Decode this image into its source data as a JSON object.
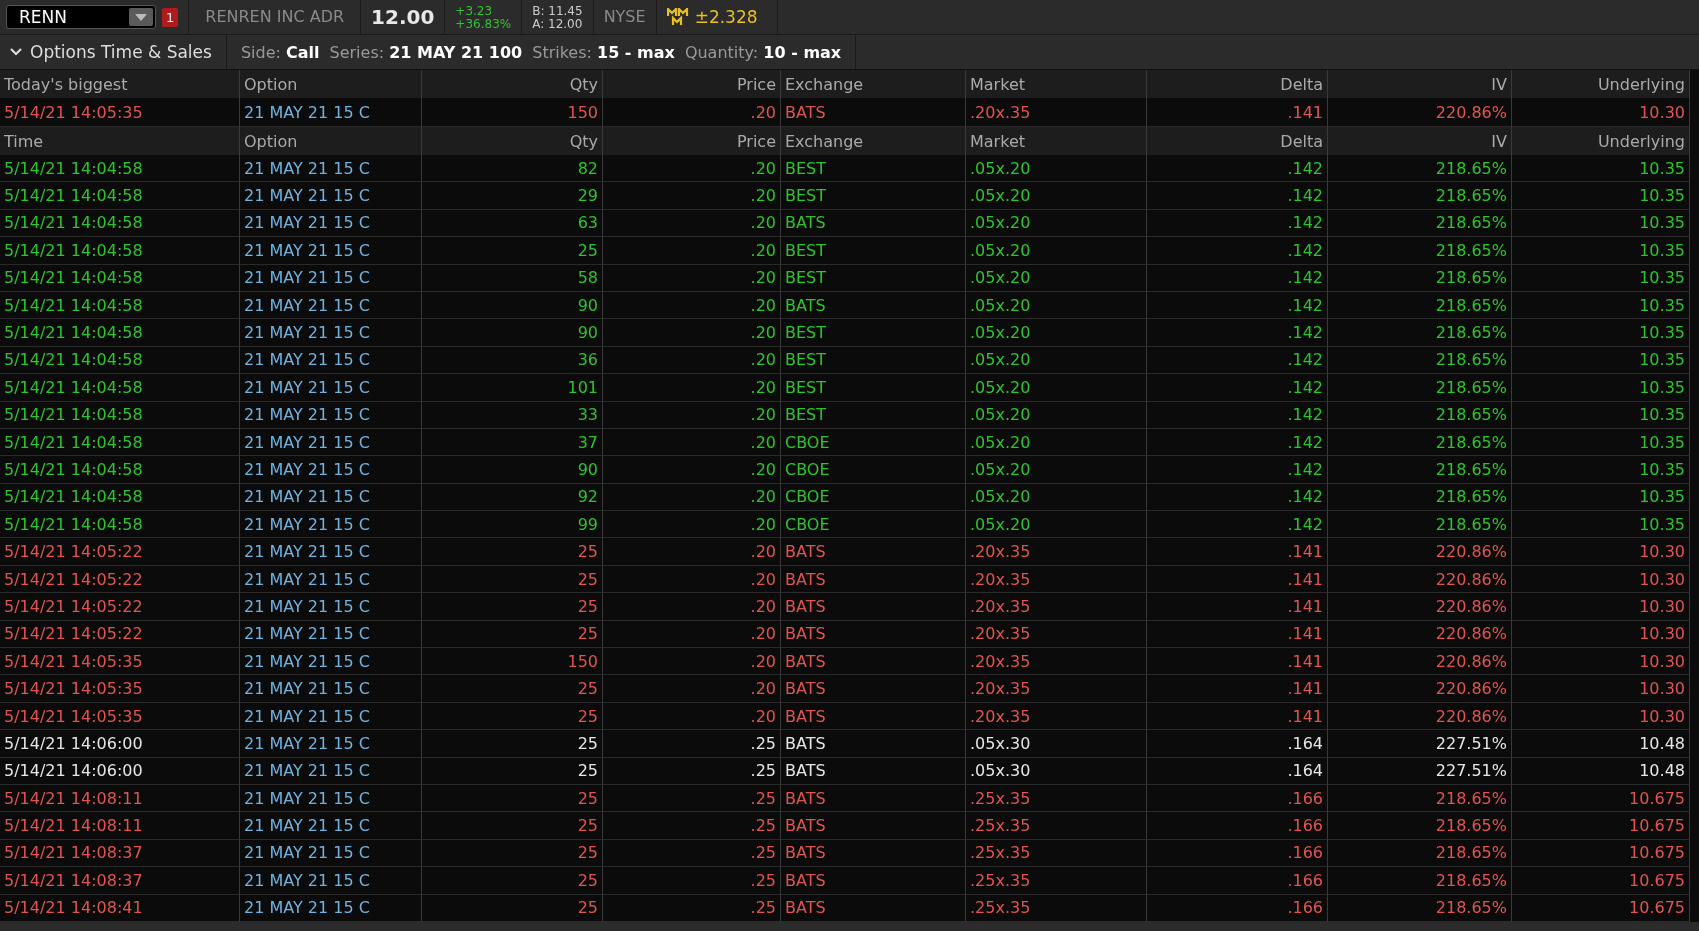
{
  "quote_bar": {
    "symbol": "RENN",
    "alert_count": "1",
    "company": "RENREN INC ADR",
    "last": "12.00",
    "change": "+3.23",
    "change_pct": "+36.83%",
    "bid": "B: 11.45",
    "ask": "A: 12.00",
    "exchange": "NYSE",
    "expected_move": "±2.328"
  },
  "panel": {
    "title": "Options Time & Sales",
    "expanded": true,
    "filters": [
      {
        "label": "Side:",
        "value": "Call"
      },
      {
        "label": "Series:",
        "value": "21 MAY 21 100"
      },
      {
        "label": "Strikes:",
        "value": "15 - max"
      },
      {
        "label": "Quantity:",
        "value": "10 - max"
      }
    ]
  },
  "biggest": {
    "columns": [
      "Today's biggest",
      "Option",
      "Qty",
      "Price",
      "Exchange",
      "Market",
      "Delta",
      "IV",
      "Underlying"
    ],
    "row": {
      "color": "#e0554f",
      "time": "5/14/21 14:05:35",
      "option": "21 MAY 21 15 C",
      "qty": "150",
      "price": ".20",
      "exchange": "BATS",
      "market": ".20x.35",
      "delta": ".141",
      "iv": "220.86%",
      "underlying": "10.30"
    }
  },
  "table": {
    "columns": [
      "Time",
      "Option",
      "Qty",
      "Price",
      "Exchange",
      "Market",
      "Delta",
      "IV",
      "Underlying"
    ],
    "rows": [
      {
        "color": "#2ec42e",
        "time": "5/14/21 14:04:58",
        "option": "21 MAY 21 15 C",
        "qty": "82",
        "price": ".20",
        "exchange": "BEST",
        "market": ".05x.20",
        "delta": ".142",
        "iv": "218.65%",
        "underlying": "10.35"
      },
      {
        "color": "#2ec42e",
        "time": "5/14/21 14:04:58",
        "option": "21 MAY 21 15 C",
        "qty": "29",
        "price": ".20",
        "exchange": "BEST",
        "market": ".05x.20",
        "delta": ".142",
        "iv": "218.65%",
        "underlying": "10.35"
      },
      {
        "color": "#2ec42e",
        "time": "5/14/21 14:04:58",
        "option": "21 MAY 21 15 C",
        "qty": "63",
        "price": ".20",
        "exchange": "BATS",
        "market": ".05x.20",
        "delta": ".142",
        "iv": "218.65%",
        "underlying": "10.35"
      },
      {
        "color": "#2ec42e",
        "time": "5/14/21 14:04:58",
        "option": "21 MAY 21 15 C",
        "qty": "25",
        "price": ".20",
        "exchange": "BEST",
        "market": ".05x.20",
        "delta": ".142",
        "iv": "218.65%",
        "underlying": "10.35"
      },
      {
        "color": "#2ec42e",
        "time": "5/14/21 14:04:58",
        "option": "21 MAY 21 15 C",
        "qty": "58",
        "price": ".20",
        "exchange": "BEST",
        "market": ".05x.20",
        "delta": ".142",
        "iv": "218.65%",
        "underlying": "10.35"
      },
      {
        "color": "#2ec42e",
        "time": "5/14/21 14:04:58",
        "option": "21 MAY 21 15 C",
        "qty": "90",
        "price": ".20",
        "exchange": "BATS",
        "market": ".05x.20",
        "delta": ".142",
        "iv": "218.65%",
        "underlying": "10.35"
      },
      {
        "color": "#2ec42e",
        "time": "5/14/21 14:04:58",
        "option": "21 MAY 21 15 C",
        "qty": "90",
        "price": ".20",
        "exchange": "BEST",
        "market": ".05x.20",
        "delta": ".142",
        "iv": "218.65%",
        "underlying": "10.35"
      },
      {
        "color": "#2ec42e",
        "time": "5/14/21 14:04:58",
        "option": "21 MAY 21 15 C",
        "qty": "36",
        "price": ".20",
        "exchange": "BEST",
        "market": ".05x.20",
        "delta": ".142",
        "iv": "218.65%",
        "underlying": "10.35"
      },
      {
        "color": "#2ec42e",
        "time": "5/14/21 14:04:58",
        "option": "21 MAY 21 15 C",
        "qty": "101",
        "price": ".20",
        "exchange": "BEST",
        "market": ".05x.20",
        "delta": ".142",
        "iv": "218.65%",
        "underlying": "10.35"
      },
      {
        "color": "#2ec42e",
        "time": "5/14/21 14:04:58",
        "option": "21 MAY 21 15 C",
        "qty": "33",
        "price": ".20",
        "exchange": "BEST",
        "market": ".05x.20",
        "delta": ".142",
        "iv": "218.65%",
        "underlying": "10.35"
      },
      {
        "color": "#2ec42e",
        "time": "5/14/21 14:04:58",
        "option": "21 MAY 21 15 C",
        "qty": "37",
        "price": ".20",
        "exchange": "CBOE",
        "market": ".05x.20",
        "delta": ".142",
        "iv": "218.65%",
        "underlying": "10.35"
      },
      {
        "color": "#2ec42e",
        "time": "5/14/21 14:04:58",
        "option": "21 MAY 21 15 C",
        "qty": "90",
        "price": ".20",
        "exchange": "CBOE",
        "market": ".05x.20",
        "delta": ".142",
        "iv": "218.65%",
        "underlying": "10.35"
      },
      {
        "color": "#2ec42e",
        "time": "5/14/21 14:04:58",
        "option": "21 MAY 21 15 C",
        "qty": "92",
        "price": ".20",
        "exchange": "CBOE",
        "market": ".05x.20",
        "delta": ".142",
        "iv": "218.65%",
        "underlying": "10.35"
      },
      {
        "color": "#2ec42e",
        "time": "5/14/21 14:04:58",
        "option": "21 MAY 21 15 C",
        "qty": "99",
        "price": ".20",
        "exchange": "CBOE",
        "market": ".05x.20",
        "delta": ".142",
        "iv": "218.65%",
        "underlying": "10.35"
      },
      {
        "color": "#e0554f",
        "time": "5/14/21 14:05:22",
        "option": "21 MAY 21 15 C",
        "qty": "25",
        "price": ".20",
        "exchange": "BATS",
        "market": ".20x.35",
        "delta": ".141",
        "iv": "220.86%",
        "underlying": "10.30"
      },
      {
        "color": "#e0554f",
        "time": "5/14/21 14:05:22",
        "option": "21 MAY 21 15 C",
        "qty": "25",
        "price": ".20",
        "exchange": "BATS",
        "market": ".20x.35",
        "delta": ".141",
        "iv": "220.86%",
        "underlying": "10.30"
      },
      {
        "color": "#e0554f",
        "time": "5/14/21 14:05:22",
        "option": "21 MAY 21 15 C",
        "qty": "25",
        "price": ".20",
        "exchange": "BATS",
        "market": ".20x.35",
        "delta": ".141",
        "iv": "220.86%",
        "underlying": "10.30"
      },
      {
        "color": "#e0554f",
        "time": "5/14/21 14:05:22",
        "option": "21 MAY 21 15 C",
        "qty": "25",
        "price": ".20",
        "exchange": "BATS",
        "market": ".20x.35",
        "delta": ".141",
        "iv": "220.86%",
        "underlying": "10.30"
      },
      {
        "color": "#e0554f",
        "time": "5/14/21 14:05:35",
        "option": "21 MAY 21 15 C",
        "qty": "150",
        "price": ".20",
        "exchange": "BATS",
        "market": ".20x.35",
        "delta": ".141",
        "iv": "220.86%",
        "underlying": "10.30"
      },
      {
        "color": "#e0554f",
        "time": "5/14/21 14:05:35",
        "option": "21 MAY 21 15 C",
        "qty": "25",
        "price": ".20",
        "exchange": "BATS",
        "market": ".20x.35",
        "delta": ".141",
        "iv": "220.86%",
        "underlying": "10.30"
      },
      {
        "color": "#e0554f",
        "time": "5/14/21 14:05:35",
        "option": "21 MAY 21 15 C",
        "qty": "25",
        "price": ".20",
        "exchange": "BATS",
        "market": ".20x.35",
        "delta": ".141",
        "iv": "220.86%",
        "underlying": "10.30"
      },
      {
        "color": "#e6e6e6",
        "time": "5/14/21 14:06:00",
        "option": "21 MAY 21 15 C",
        "qty": "25",
        "price": ".25",
        "exchange": "BATS",
        "market": ".05x.30",
        "delta": ".164",
        "iv": "227.51%",
        "underlying": "10.48"
      },
      {
        "color": "#e6e6e6",
        "time": "5/14/21 14:06:00",
        "option": "21 MAY 21 15 C",
        "qty": "25",
        "price": ".25",
        "exchange": "BATS",
        "market": ".05x.30",
        "delta": ".164",
        "iv": "227.51%",
        "underlying": "10.48"
      },
      {
        "color": "#e0554f",
        "time": "5/14/21 14:08:11",
        "option": "21 MAY 21 15 C",
        "qty": "25",
        "price": ".25",
        "exchange": "BATS",
        "market": ".25x.35",
        "delta": ".166",
        "iv": "218.65%",
        "underlying": "10.675"
      },
      {
        "color": "#e0554f",
        "time": "5/14/21 14:08:11",
        "option": "21 MAY 21 15 C",
        "qty": "25",
        "price": ".25",
        "exchange": "BATS",
        "market": ".25x.35",
        "delta": ".166",
        "iv": "218.65%",
        "underlying": "10.675"
      },
      {
        "color": "#e0554f",
        "time": "5/14/21 14:08:37",
        "option": "21 MAY 21 15 C",
        "qty": "25",
        "price": ".25",
        "exchange": "BATS",
        "market": ".25x.35",
        "delta": ".166",
        "iv": "218.65%",
        "underlying": "10.675"
      },
      {
        "color": "#e0554f",
        "time": "5/14/21 14:08:37",
        "option": "21 MAY 21 15 C",
        "qty": "25",
        "price": ".25",
        "exchange": "BATS",
        "market": ".25x.35",
        "delta": ".166",
        "iv": "218.65%",
        "underlying": "10.675"
      },
      {
        "color": "#e0554f",
        "time": "5/14/21 14:08:41",
        "option": "21 MAY 21 15 C",
        "qty": "25",
        "price": ".25",
        "exchange": "BATS",
        "market": ".25x.35",
        "delta": ".166",
        "iv": "218.65%",
        "underlying": "10.675"
      }
    ]
  }
}
